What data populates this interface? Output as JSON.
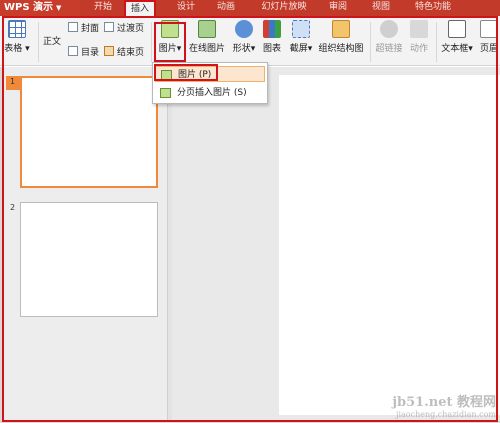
{
  "app": {
    "name": "WPS 演示"
  },
  "tabs": [
    {
      "label": "开始"
    },
    {
      "label": "插入"
    },
    {
      "label": "设计"
    },
    {
      "label": "动画"
    },
    {
      "label": "幻灯片放映"
    },
    {
      "label": "审阅"
    },
    {
      "label": "视图"
    },
    {
      "label": "特色功能"
    }
  ],
  "ribbon": {
    "table": "表格",
    "body_slide": "正文",
    "cover": "封面",
    "toc": "目录",
    "transition": "过渡页",
    "end": "结束页",
    "picture": "图片",
    "online_picture": "在线图片",
    "shapes": "形状",
    "chart": "图表",
    "screenshot": "截屏",
    "org_chart": "组织结构图",
    "hyperlink": "超链接",
    "action": "动作",
    "textbox": "文本框",
    "header_footer": "页眉"
  },
  "dropdown": {
    "items": [
      {
        "label": "图片 (P)"
      },
      {
        "label": "分页插入图片 (S)"
      }
    ]
  },
  "slides": {
    "numbers": [
      "1",
      "2"
    ]
  },
  "watermark": {
    "line1": "jb51.net  教程网",
    "line2": "jiaocheng.chazidian.com"
  },
  "colors": {
    "title_bar": "#c23a2a",
    "annotation": "#d0121b",
    "selected_thumb": "#f08a3a"
  }
}
